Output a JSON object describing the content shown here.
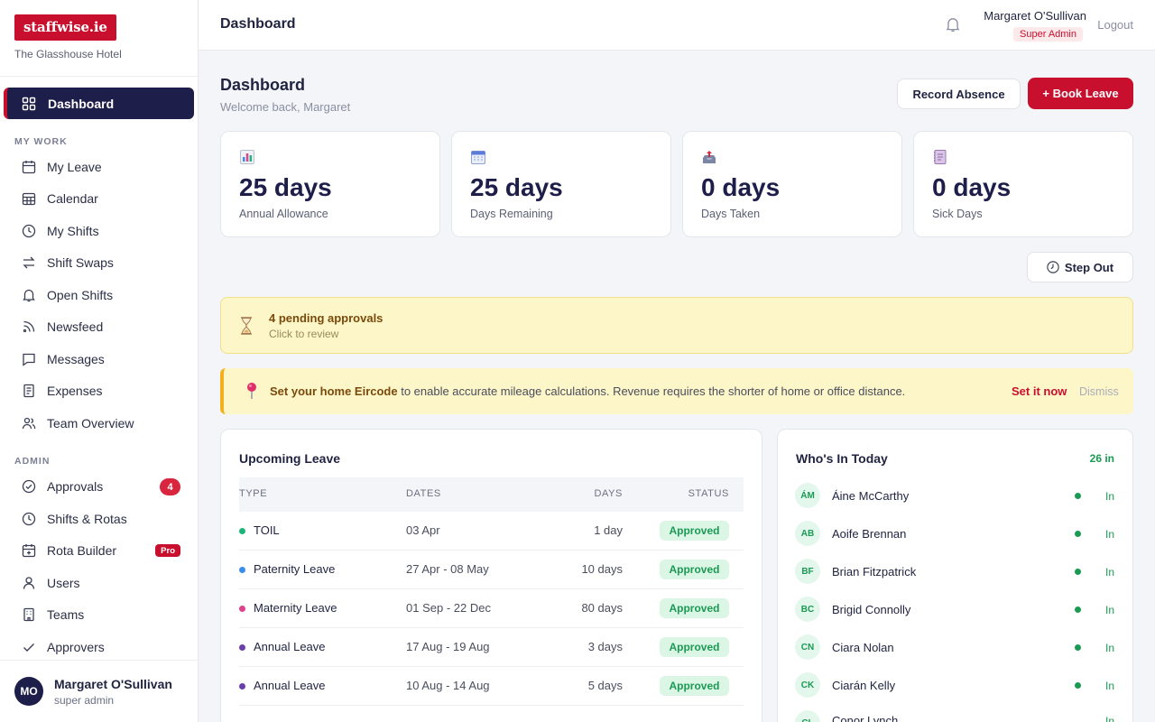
{
  "brand": {
    "logo": "staffwise.ie",
    "org": "The Glasshouse Hotel"
  },
  "nav": {
    "active": "Dashboard",
    "my_work_label": "MY WORK",
    "my_work": [
      "My Leave",
      "Calendar",
      "My Shifts",
      "Shift Swaps",
      "Open Shifts",
      "Newsfeed",
      "Messages",
      "Expenses",
      "Team Overview"
    ],
    "admin_label": "ADMIN",
    "admin": [
      "Approvals",
      "Shifts & Rotas",
      "Rota Builder",
      "Users",
      "Teams",
      "Approvers"
    ],
    "approvals_badge": "4",
    "rota_badge": "Pro"
  },
  "footer_user": {
    "initials": "MO",
    "name": "Margaret O'Sullivan",
    "role": "super admin"
  },
  "topbar": {
    "title": "Dashboard",
    "user": "Margaret O'Sullivan",
    "role": "Super Admin",
    "logout": "Logout"
  },
  "page": {
    "title": "Dashboard",
    "welcome": "Welcome back, Margaret",
    "record_absence": "Record Absence",
    "book_leave": "+ Book Leave",
    "step_out": "Step Out"
  },
  "stats": [
    {
      "value": "25 days",
      "label": "Annual Allowance",
      "icon": "bar-chart-icon"
    },
    {
      "value": "25 days",
      "label": "Days Remaining",
      "icon": "calendar-icon"
    },
    {
      "value": "0 days",
      "label": "Days Taken",
      "icon": "outbox-icon"
    },
    {
      "value": "0 days",
      "label": "Sick Days",
      "icon": "notebook-icon"
    }
  ],
  "pending": {
    "title": "4 pending approvals",
    "sub": "Click to review"
  },
  "eircode": {
    "bold": "Set your home Eircode",
    "rest": " to enable accurate mileage calculations. Revenue requires the shorter of home or office distance.",
    "action": "Set it now",
    "dismiss": "Dismiss"
  },
  "upcoming": {
    "title": "Upcoming Leave",
    "headers": [
      "TYPE",
      "DATES",
      "DAYS",
      "STATUS"
    ],
    "rows": [
      {
        "type": "TOIL",
        "dates": "03 Apr",
        "days": "1 day",
        "status": "Approved",
        "color": "#1fb57a"
      },
      {
        "type": "Paternity Leave",
        "dates": "27 Apr - 08 May",
        "days": "10 days",
        "status": "Approved",
        "color": "#3b8ee8"
      },
      {
        "type": "Maternity Leave",
        "dates": "01 Sep - 22 Dec",
        "days": "80 days",
        "status": "Approved",
        "color": "#e0418a"
      },
      {
        "type": "Annual Leave",
        "dates": "17 Aug - 19 Aug",
        "days": "3 days",
        "status": "Approved",
        "color": "#6b3fa8"
      },
      {
        "type": "Annual Leave",
        "dates": "10 Aug - 14 Aug",
        "days": "5 days",
        "status": "Approved",
        "color": "#6b3fa8"
      }
    ]
  },
  "whos_in": {
    "title": "Who's In Today",
    "count": "26 in",
    "people": [
      {
        "initials": "ÁM",
        "name": "Áine McCarthy",
        "status": "In"
      },
      {
        "initials": "AB",
        "name": "Aoife Brennan",
        "status": "In"
      },
      {
        "initials": "BF",
        "name": "Brian Fitzpatrick",
        "status": "In"
      },
      {
        "initials": "BC",
        "name": "Brigid Connolly",
        "status": "In"
      },
      {
        "initials": "CN",
        "name": "Ciara Nolan",
        "status": "In"
      },
      {
        "initials": "CK",
        "name": "Ciarán Kelly",
        "status": "In"
      },
      {
        "initials": "CL",
        "name": "Conor Lynch",
        "status": "In"
      }
    ]
  }
}
